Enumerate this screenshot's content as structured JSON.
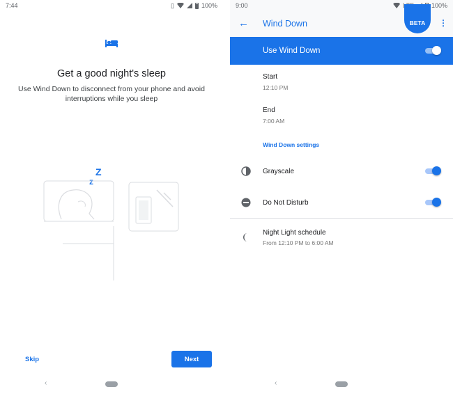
{
  "left": {
    "status": {
      "time": "7:44",
      "battery": "100%"
    },
    "title": "Get a good night's sleep",
    "description": "Use Wind Down to disconnect from your phone and avoid interruptions while you sleep",
    "zzz": "z",
    "zzz_big": "Z",
    "skip_label": "Skip",
    "next_label": "Next",
    "nav_back": "‹"
  },
  "right": {
    "status": {
      "time": "9:00",
      "network": "LTE",
      "battery": "100%"
    },
    "appbar": {
      "back": "←",
      "title": "Wind Down",
      "badge": "BETA",
      "more": "⋮"
    },
    "master_toggle": {
      "label": "Use Wind Down",
      "on": true
    },
    "start": {
      "label": "Start",
      "value": "12:10 PM"
    },
    "end": {
      "label": "End",
      "value": "7:00 AM"
    },
    "section_header": "Wind Down settings",
    "grayscale": {
      "label": "Grayscale",
      "icon": "contrast-icon",
      "on": true
    },
    "dnd": {
      "label": "Do Not Disturb",
      "icon": "do-not-disturb-icon",
      "on": true
    },
    "night_light": {
      "label": "Night Light schedule",
      "value": "From 12:10 PM to 6:00 AM",
      "icon": "moon-icon"
    },
    "nav_back": "‹"
  },
  "colors": {
    "accent": "#1a73e8",
    "text": "#202124",
    "secondary": "#757575"
  }
}
